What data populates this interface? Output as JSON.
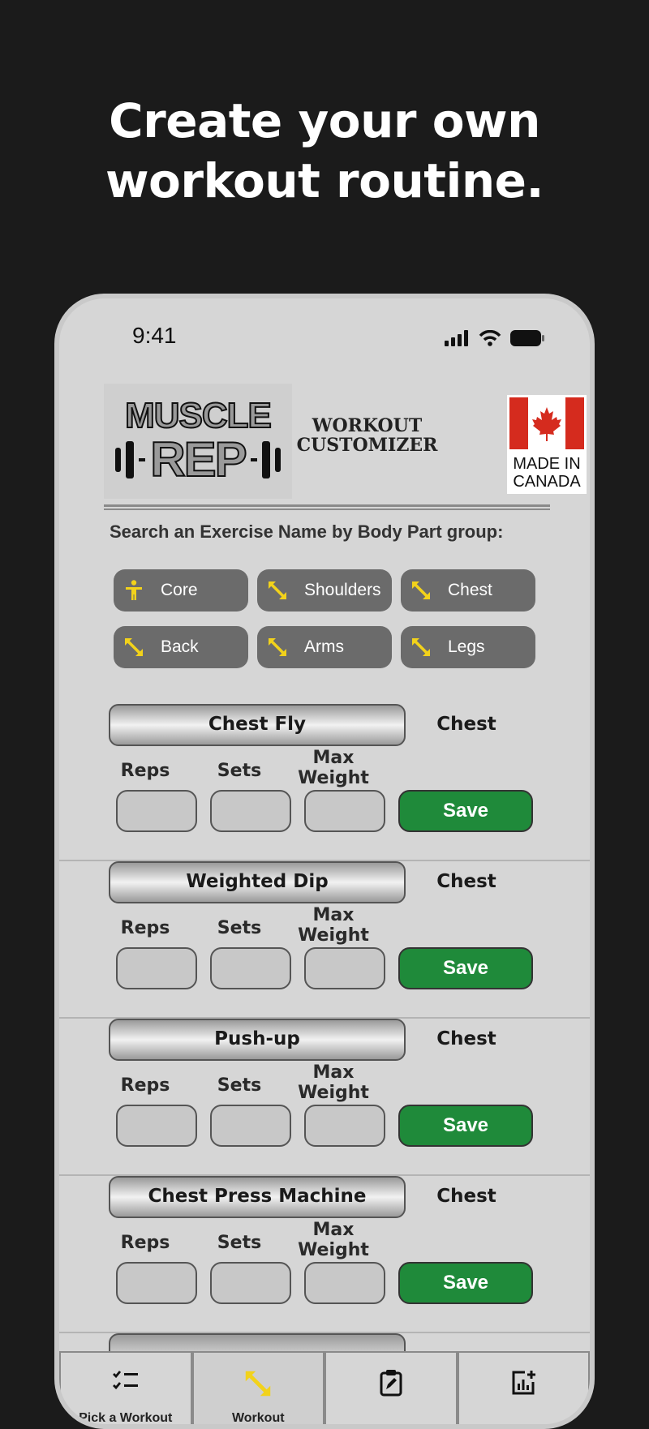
{
  "headline": {
    "line1": "Create your own",
    "line2": "workout routine."
  },
  "status_bar": {
    "time": "9:41"
  },
  "header": {
    "logo_line1": "MUSCLE",
    "logo_line2": "REP",
    "title_line1": "WORKOUT",
    "title_line2": "CUSTOMIZER",
    "badge_line1": "MADE IN",
    "badge_line2": "CANADA"
  },
  "search": {
    "label": "Search an Exercise Name by Body Part group:"
  },
  "body_parts": [
    {
      "label": "Core",
      "icon": "person-icon"
    },
    {
      "label": "Shoulders",
      "icon": "resize-arrow-icon"
    },
    {
      "label": "Chest",
      "icon": "resize-arrow-icon"
    },
    {
      "label": "Back",
      "icon": "resize-arrow-icon"
    },
    {
      "label": "Arms",
      "icon": "resize-arrow-icon"
    },
    {
      "label": "Legs",
      "icon": "resize-arrow-icon"
    }
  ],
  "columns": {
    "reps": "Reps",
    "sets": "Sets",
    "max_line1": "Max",
    "max_line2": "Weight"
  },
  "exercises": [
    {
      "name": "Chest Fly",
      "part": "Chest",
      "save": "Save"
    },
    {
      "name": "Weighted Dip",
      "part": "Chest",
      "save": "Save"
    },
    {
      "name": "Push-up",
      "part": "Chest",
      "save": "Save"
    },
    {
      "name": "Chest Press Machine",
      "part": "Chest",
      "save": "Save"
    }
  ],
  "colors": {
    "background": "#1b1b1b",
    "chip": "#6b6b6b",
    "accent_yellow": "#f2d21b",
    "save_green": "#1f8a3a"
  },
  "bottom_nav": [
    {
      "icon": "checklist-icon",
      "label": "Pick a Workout"
    },
    {
      "icon": "resize-arrow-icon",
      "label": "Workout"
    },
    {
      "icon": "clipboard-edit-icon",
      "label": ""
    },
    {
      "icon": "chart-add-icon",
      "label": ""
    }
  ]
}
